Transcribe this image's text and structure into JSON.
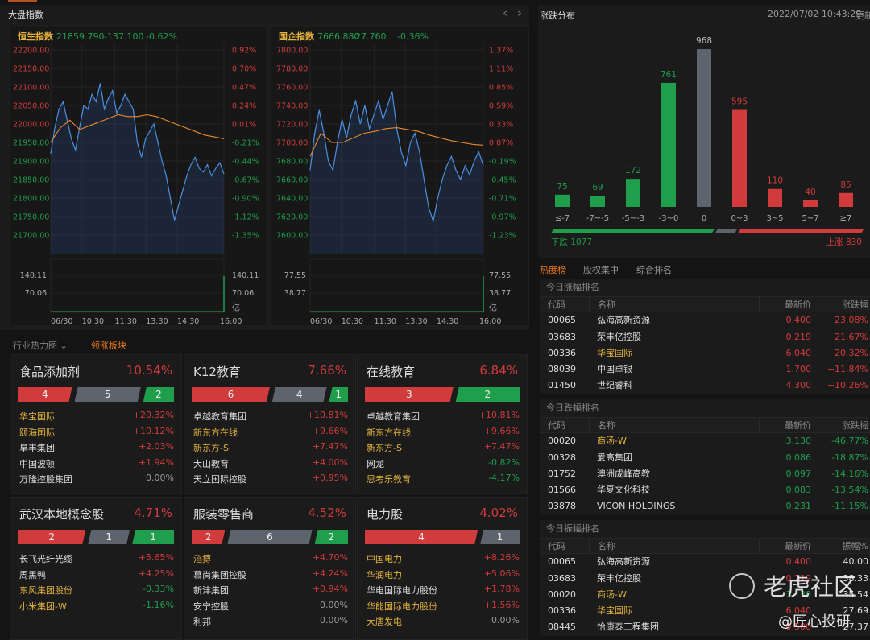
{
  "colors": {
    "red": "#d23b3b",
    "green": "#1f9e4c",
    "gray": "#5e646e",
    "yellow": "#e3b23c",
    "orange": "#f07a1e",
    "line": "#4a90e2",
    "avg": "#e8892d"
  },
  "index_panel": {
    "title": "大盘指数",
    "prev_icon": "chevron-left-icon",
    "next_icon": "chevron-right-icon",
    "charts": [
      {
        "name": "恒生指数",
        "price": "21859.790",
        "change": "-137.100",
        "pct": "-0.62%",
        "left_axis": [
          "22200.00",
          "22150.00",
          "22100.00",
          "22050.00",
          "22000.00",
          "21950.00",
          "21900.00",
          "21850.00",
          "21800.00",
          "21750.00",
          "21700.00"
        ],
        "right_axis": [
          "0.92%",
          "0.70%",
          "0.47%",
          "0.24%",
          "0.01%",
          "-0.21%",
          "-0.44%",
          "-0.67%",
          "-0.90%",
          "-1.12%",
          "-1.35%"
        ],
        "ymax": 22200,
        "ymin": 21700,
        "red_count": 5,
        "series": [
          21920,
          21990,
          22040,
          22060,
          22010,
          21960,
          21930,
          21990,
          22050,
          22040,
          22080,
          22060,
          22110,
          22040,
          22070,
          22090,
          22030,
          22050,
          22080,
          22060,
          22040,
          21950,
          21910,
          21960,
          21980,
          22000,
          21950,
          21900,
          21860,
          21800,
          21740,
          21780,
          21820,
          21860,
          21890,
          21910,
          21880,
          21870,
          21890,
          21860,
          21880,
          21895,
          21865
        ],
        "avg": [
          21950,
          21990,
          22010,
          21985,
          21995,
          22005,
          22015,
          22025,
          22020,
          22020,
          22025,
          22020,
          22010,
          22000,
          21990,
          21980,
          21970,
          21965,
          21960
        ],
        "vol_axis": [
          "140.11",
          "70.06"
        ],
        "vol_unit": "亿",
        "time_axis": [
          "06/30",
          "10:30",
          "11:30",
          "13:30",
          "14:30",
          "16:00"
        ]
      },
      {
        "name": "国企指数",
        "price": "7666.880",
        "change": "-27.760",
        "pct": "-0.36%",
        "left_axis": [
          "7800.00",
          "7780.00",
          "7760.00",
          "7740.00",
          "7720.00",
          "7700.00",
          "7680.00",
          "7660.00",
          "7640.00",
          "7620.00",
          "7600.00"
        ],
        "right_axis": [
          "1.37%",
          "1.11%",
          "0.85%",
          "0.59%",
          "0.33%",
          "0.07%",
          "-0.19%",
          "-0.45%",
          "-0.71%",
          "-0.97%",
          "-1.23%"
        ],
        "ymax": 7800,
        "ymin": 7600,
        "red_count": 6,
        "series": [
          7670,
          7710,
          7735,
          7710,
          7680,
          7670,
          7700,
          7725,
          7705,
          7730,
          7745,
          7720,
          7740,
          7715,
          7730,
          7745,
          7725,
          7740,
          7755,
          7715,
          7690,
          7675,
          7700,
          7710,
          7690,
          7660,
          7630,
          7615,
          7640,
          7660,
          7675,
          7685,
          7670,
          7660,
          7675,
          7665,
          7680,
          7690,
          7675
        ],
        "avg": [
          7685,
          7710,
          7700,
          7700,
          7705,
          7710,
          7712,
          7715,
          7716,
          7714,
          7712,
          7708,
          7705,
          7702,
          7700,
          7698,
          7697
        ],
        "vol_axis": [
          "77.55",
          "38.77"
        ],
        "vol_unit": "亿",
        "time_axis": [
          "06/30",
          "10:30",
          "11:30",
          "13:30",
          "14:30",
          "16:00"
        ]
      }
    ]
  },
  "heatmap": {
    "tab_industry": "行业热力图",
    "tab_leading": "领涨板块",
    "cards": [
      {
        "title": "食品添加剂",
        "pct": "10.54%",
        "counts": [
          4,
          5,
          2
        ],
        "rows": [
          [
            "华宝国际",
            "+20.32%",
            "y",
            "r"
          ],
          [
            "颐海国际",
            "+10.12%",
            "y",
            "r"
          ],
          [
            "阜丰集团",
            "+2.03%",
            "w",
            "r"
          ],
          [
            "中国波顿",
            "+1.94%",
            "w",
            "r"
          ],
          [
            "万隆控股集团",
            "0.00%",
            "w",
            "g0"
          ]
        ]
      },
      {
        "title": "K12教育",
        "pct": "7.66%",
        "counts": [
          6,
          4,
          1
        ],
        "rows": [
          [
            "卓越教育集团",
            "+10.81%",
            "w",
            "r"
          ],
          [
            "新东方在线",
            "+9.66%",
            "y",
            "r"
          ],
          [
            "新东方-S",
            "+7.47%",
            "y",
            "r"
          ],
          [
            "大山教育",
            "+4.00%",
            "w",
            "r"
          ],
          [
            "天立国际控股",
            "+0.95%",
            "w",
            "r"
          ]
        ]
      },
      {
        "title": "在线教育",
        "pct": "6.84%",
        "counts": [
          3,
          0,
          2
        ],
        "rows": [
          [
            "卓越教育集团",
            "+10.81%",
            "w",
            "r"
          ],
          [
            "新东方在线",
            "+9.66%",
            "y",
            "r"
          ],
          [
            "新东方-S",
            "+7.47%",
            "y",
            "r"
          ],
          [
            "网龙",
            "-0.82%",
            "w",
            "g"
          ],
          [
            "思考乐教育",
            "-4.17%",
            "y",
            "g"
          ]
        ]
      },
      {
        "title": "武汉本地概念股",
        "pct": "4.71%",
        "counts": [
          2,
          1,
          1
        ],
        "rows": [
          [
            "长飞光纤光缆",
            "+5.65%",
            "w",
            "r"
          ],
          [
            "周黑鸭",
            "+4.25%",
            "w",
            "r"
          ],
          [
            "东风集团股份",
            "-0.33%",
            "y",
            "g"
          ],
          [
            "小米集团-W",
            "-1.16%",
            "y",
            "g"
          ]
        ]
      },
      {
        "title": "服装零售商",
        "pct": "4.52%",
        "counts": [
          2,
          6,
          2
        ],
        "rows": [
          [
            "滔搏",
            "+4.70%",
            "y",
            "r"
          ],
          [
            "慕尚集团控股",
            "+4.24%",
            "w",
            "r"
          ],
          [
            "新沣集团",
            "+0.94%",
            "w",
            "r"
          ],
          [
            "安宁控股",
            "0.00%",
            "w",
            "g0"
          ],
          [
            "利邦",
            "0.00%",
            "w",
            "g0"
          ]
        ]
      },
      {
        "title": "电力股",
        "pct": "4.02%",
        "counts": [
          4,
          1,
          0
        ],
        "rows": [
          [
            "中国电力",
            "+8.26%",
            "y",
            "r"
          ],
          [
            "华润电力",
            "+5.06%",
            "y",
            "r"
          ],
          [
            "华电国际电力股份",
            "+1.78%",
            "w",
            "r"
          ],
          [
            "华能国际电力股份",
            "+1.56%",
            "y",
            "r"
          ],
          [
            "大唐发电",
            "0.00%",
            "y",
            "g0"
          ]
        ]
      }
    ]
  },
  "distribution": {
    "title": "涨跌分布",
    "timestamp": "2022/07/02 10:43:29",
    "refresh": "更新",
    "categories": [
      "≤-7",
      "-7~-5",
      "-5~-3",
      "-3~0",
      "0",
      "0~3",
      "3~5",
      "5~7",
      "≥7"
    ],
    "values": [
      75,
      69,
      172,
      761,
      968,
      595,
      110,
      40,
      85
    ],
    "kinds": [
      "g",
      "g",
      "g",
      "g",
      "n",
      "r",
      "r",
      "r",
      "r"
    ],
    "down_label": "下跌 1077",
    "up_label": "上涨 830",
    "down": 1077,
    "flat": 968,
    "up": 830
  },
  "rank_tabs": [
    "热度榜",
    "股权集中",
    "综合排名"
  ],
  "tables": [
    {
      "title": "今日涨幅排名",
      "headers": [
        "代码",
        "名称",
        "最新价",
        "涨跌幅"
      ],
      "rows": [
        [
          "00065",
          "弘海高新资源",
          "0.400",
          "+23.08%",
          "w",
          "r"
        ],
        [
          "03683",
          "荣丰亿控股",
          "0.219",
          "+21.67%",
          "w",
          "r"
        ],
        [
          "00336",
          "华宝国际",
          "6.040",
          "+20.32%",
          "y",
          "r"
        ],
        [
          "08039",
          "中国卓银",
          "1.700",
          "+11.84%",
          "w",
          "r"
        ],
        [
          "01450",
          "世纪睿科",
          "4.300",
          "+10.26%",
          "w",
          "r"
        ]
      ]
    },
    {
      "title": "今日跌幅排名",
      "headers": [
        "代码",
        "名称",
        "最新价",
        "涨跌幅"
      ],
      "rows": [
        [
          "00020",
          "商汤-W",
          "3.130",
          "-46.77%",
          "y",
          "g"
        ],
        [
          "00328",
          "爱高集团",
          "0.086",
          "-18.87%",
          "w",
          "g"
        ],
        [
          "01752",
          "澳洲成峰高教",
          "0.097",
          "-14.16%",
          "w",
          "g"
        ],
        [
          "01566",
          "华夏文化科技",
          "0.083",
          "-13.54%",
          "w",
          "g"
        ],
        [
          "03878",
          "VICON HOLDINGS",
          "0.231",
          "-11.15%",
          "w",
          "g"
        ]
      ]
    },
    {
      "title": "今日振幅排名",
      "headers": [
        "代码",
        "名称",
        "最新价",
        "振幅%"
      ],
      "rows": [
        [
          "00065",
          "弘海高新资源",
          "0.400",
          "40.00",
          "w",
          "r"
        ],
        [
          "03683",
          "荣丰亿控股",
          "0.219",
          "38.33",
          "w",
          "r"
        ],
        [
          "00020",
          "商汤-W",
          "3.130",
          "35.54",
          "y",
          "g"
        ],
        [
          "00336",
          "华宝国际",
          "6.040",
          "27.69",
          "y",
          "r"
        ],
        [
          "08445",
          "怡康泰工程集团",
          "0.500",
          "27.37",
          "w",
          "r"
        ]
      ]
    }
  ],
  "watermark": {
    "brand": "老虎社区",
    "author": "@匠心投研"
  }
}
